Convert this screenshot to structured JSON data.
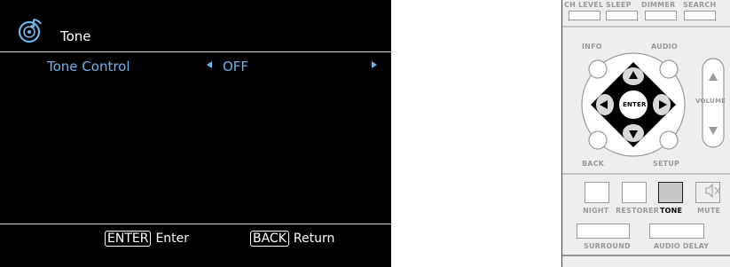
{
  "screen": {
    "title": "Tone",
    "icon": "music-disc-icon",
    "menu": {
      "label": "Tone Control",
      "value": "OFF"
    },
    "footer": {
      "enter_key": "ENTER",
      "enter_label": "Enter",
      "back_key": "BACK",
      "back_label": "Return"
    },
    "colors": {
      "background": "#000000",
      "highlight": "#6fb3e8",
      "text": "#ffffff"
    }
  },
  "remote": {
    "top_labels": [
      "CH LEVEL",
      "SLEEP",
      "DIMMER",
      "SEARCH"
    ],
    "info": "INFO",
    "audio": "AUDIO",
    "enter": "ENTER",
    "volume": "VOLUME",
    "back": "BACK",
    "setup": "SETUP",
    "bottom_labels": [
      "NIGHT",
      "RESTORER",
      "TONE",
      "MUTE"
    ],
    "surround": "SURROUND",
    "audio_delay": "AUDIO DELAY",
    "selected_button": "TONE"
  }
}
